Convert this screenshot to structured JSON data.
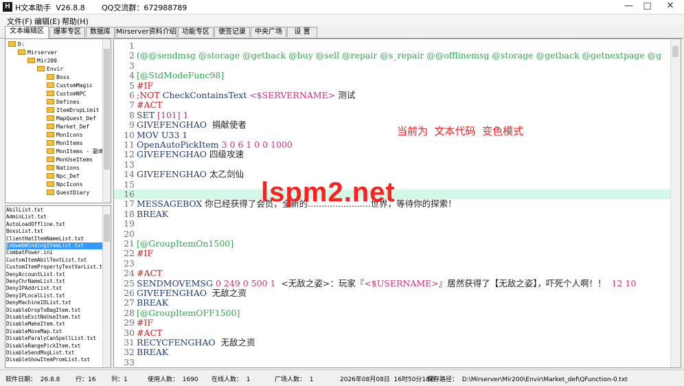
{
  "window": {
    "app_icon_letter": "H",
    "title": "H文本助手  V26.8.8",
    "qq_group": "QQ交流群：672988789",
    "min_glyph": "—",
    "max_glyph": "□",
    "close_glyph": "✕"
  },
  "menu": [
    "文件(F)",
    "编辑(E)",
    "帮助(H)"
  ],
  "tabs": [
    "文本编辑区",
    "爆率专区",
    "数据库",
    "Mirserver资料介绍",
    "功能专区",
    "便签记录",
    "中央广场",
    "设 置"
  ],
  "active_tab": 0,
  "tree": [
    {
      "label": "D:",
      "level": 0
    },
    {
      "label": "Mirserver",
      "level": 1
    },
    {
      "label": "Mir200",
      "level": 2
    },
    {
      "label": "Envir",
      "level": 3
    },
    {
      "label": "Boss",
      "level": 4
    },
    {
      "label": "CustomMagic",
      "level": 4
    },
    {
      "label": "CustomNPC",
      "level": 4
    },
    {
      "label": "Defines",
      "level": 4
    },
    {
      "label": "ItemDropLimit",
      "level": 4
    },
    {
      "label": "MapQuest_Def",
      "level": 4
    },
    {
      "label": "Market_Def",
      "level": 4
    },
    {
      "label": "MonIcons",
      "level": 4
    },
    {
      "label": "MonItems",
      "level": 4
    },
    {
      "label": "MonItems - 副本",
      "level": 4
    },
    {
      "label": "MonUseItems",
      "level": 4
    },
    {
      "label": "Nations",
      "level": 4
    },
    {
      "label": "Npc_Def",
      "level": 4
    },
    {
      "label": "NpcIcons",
      "level": 4
    },
    {
      "label": "QuestDiary",
      "level": 4
    }
  ],
  "files": [
    "AbilList.txt",
    "AdminList.txt",
    "AutoLoadOffline.txt",
    "BoxsList.txt",
    "ClientHatItemNameList.txt",
    "CobwebWindingItemList.txt",
    "CombatPower.ini",
    "CustomItemAbilTextList.txt",
    "CustomItemPropertyTextVarList.t",
    "DenyAccountList.txt",
    "DenyChrNameList.txt",
    "DenyIPAddrList.txt",
    "DenyIPLocalList.txt",
    "DenyMachineIDList.txt",
    "DisableDropToBagItem.txt",
    "DisableExitNoUseItem.txt",
    "DisableMakeItem.txt",
    "DisableMoveMap.txt",
    "DisableParalyCanSpellList.txt",
    "DisableRangePickItem.txt",
    "DisableSendMsgList.txt",
    "DisableShowItemPromList.txt"
  ],
  "selected_file": 5,
  "code_lines": [
    {
      "n": "1",
      "parts": []
    },
    {
      "n": "2",
      "parts": [
        [
          "(@@sendmsg @storage @getback @buy @sell @repair @s_repair @@offlinemsg @storage @getback @getnextpage @g",
          "green"
        ]
      ]
    },
    {
      "n": "3",
      "parts": []
    },
    {
      "n": "4",
      "parts": [
        [
          "[@StdModeFunc98]",
          "green"
        ]
      ]
    },
    {
      "n": "5",
      "parts": [
        [
          "#IF",
          "red"
        ]
      ]
    },
    {
      "n": "6",
      "parts": [
        [
          ";NOT ",
          "red"
        ],
        [
          "CheckContainsText ",
          "dark"
        ],
        [
          "<$SERVERNAME>",
          "mag"
        ],
        [
          " 测试",
          "black"
        ]
      ]
    },
    {
      "n": "7",
      "parts": [
        [
          "#ACT",
          "red"
        ]
      ]
    },
    {
      "n": "8",
      "parts": [
        [
          "SET ",
          "dark"
        ],
        [
          "[101] 1",
          "mag"
        ]
      ]
    },
    {
      "n": "9",
      "parts": [
        [
          "GIVEFENGHAO",
          "dark"
        ],
        [
          "  捐献使者",
          "black"
        ]
      ]
    },
    {
      "n": "10",
      "parts": [
        [
          "MOV U33 1",
          "dark"
        ]
      ]
    },
    {
      "n": "11",
      "parts": [
        [
          "OpenAutoPickItem ",
          "dark"
        ],
        [
          "3 0 6 1 0 0 1000",
          "mag"
        ]
      ]
    },
    {
      "n": "12",
      "parts": [
        [
          "GIVEFENGHAO",
          "dark"
        ],
        [
          " 四级攻速",
          "black"
        ]
      ]
    },
    {
      "n": "13",
      "parts": []
    },
    {
      "n": "14",
      "parts": [
        [
          "GIVEFENGHAO",
          "dark"
        ],
        [
          " 太乙剑仙",
          "black"
        ]
      ]
    },
    {
      "n": "15",
      "parts": []
    },
    {
      "n": "16",
      "parts": []
    },
    {
      "n": "17",
      "parts": [
        [
          "MESSAGEBOX",
          "dark"
        ],
        [
          " 你已经获得了会员，全新的.......................世界，等待你的探索！",
          "black"
        ]
      ]
    },
    {
      "n": "18",
      "parts": [
        [
          "BREAK",
          "dark"
        ]
      ]
    },
    {
      "n": "19",
      "parts": []
    },
    {
      "n": "20",
      "parts": []
    },
    {
      "n": "21",
      "parts": [
        [
          "[@GroupItemOn1500]",
          "green"
        ]
      ]
    },
    {
      "n": "22",
      "parts": [
        [
          "#IF",
          "red"
        ]
      ]
    },
    {
      "n": "23",
      "parts": []
    },
    {
      "n": "24",
      "parts": [
        [
          "#ACT",
          "red"
        ]
      ]
    },
    {
      "n": "25",
      "parts": [
        [
          "SENDMOVEMSG ",
          "dark"
        ],
        [
          "0 249 0 500 1",
          "mag"
        ],
        [
          "  <无敌之姿>：玩家『",
          "black"
        ],
        [
          "<$USERNAME>",
          "mag"
        ],
        [
          "』居然获得了【无敌之姿】，吓死个人啊！！  ",
          "black"
        ],
        [
          "12 10",
          "mag"
        ]
      ]
    },
    {
      "n": "26",
      "parts": [
        [
          "GIVEFENGHAO",
          "dark"
        ],
        [
          "  无敌之资",
          "black"
        ]
      ]
    },
    {
      "n": "27",
      "parts": [
        [
          "BREAK",
          "dark"
        ]
      ]
    },
    {
      "n": "28",
      "parts": [
        [
          "[@GroupItemOFF1500]",
          "green"
        ]
      ]
    },
    {
      "n": "29",
      "parts": [
        [
          "#IF",
          "red"
        ]
      ]
    },
    {
      "n": "30",
      "parts": [
        [
          "#ACT",
          "red"
        ]
      ]
    },
    {
      "n": "31",
      "parts": [
        [
          "RECYCFENGHAO",
          "dark"
        ],
        [
          "  无敌之资",
          "black"
        ]
      ]
    },
    {
      "n": "32",
      "parts": [
        [
          "BREAK",
          "dark"
        ]
      ]
    },
    {
      "n": "33",
      "parts": []
    }
  ],
  "current_line": 16,
  "mode_note": "当前为  文本代码  变色模式",
  "watermark": "lspm2.net",
  "status": {
    "software_date": "软件日期：  26.8.8",
    "row": "行：16",
    "col": "列：1",
    "users": "使用人数：  1690",
    "online": "在线人数：  1",
    "square": "广场人数：  1",
    "datetime": "2026年08月08日  16时50分18秒",
    "save_path": "保存路径：  D:\\Mirserver\\Mir200\\Envir\\Market_def\\QFunction-0.txt"
  }
}
